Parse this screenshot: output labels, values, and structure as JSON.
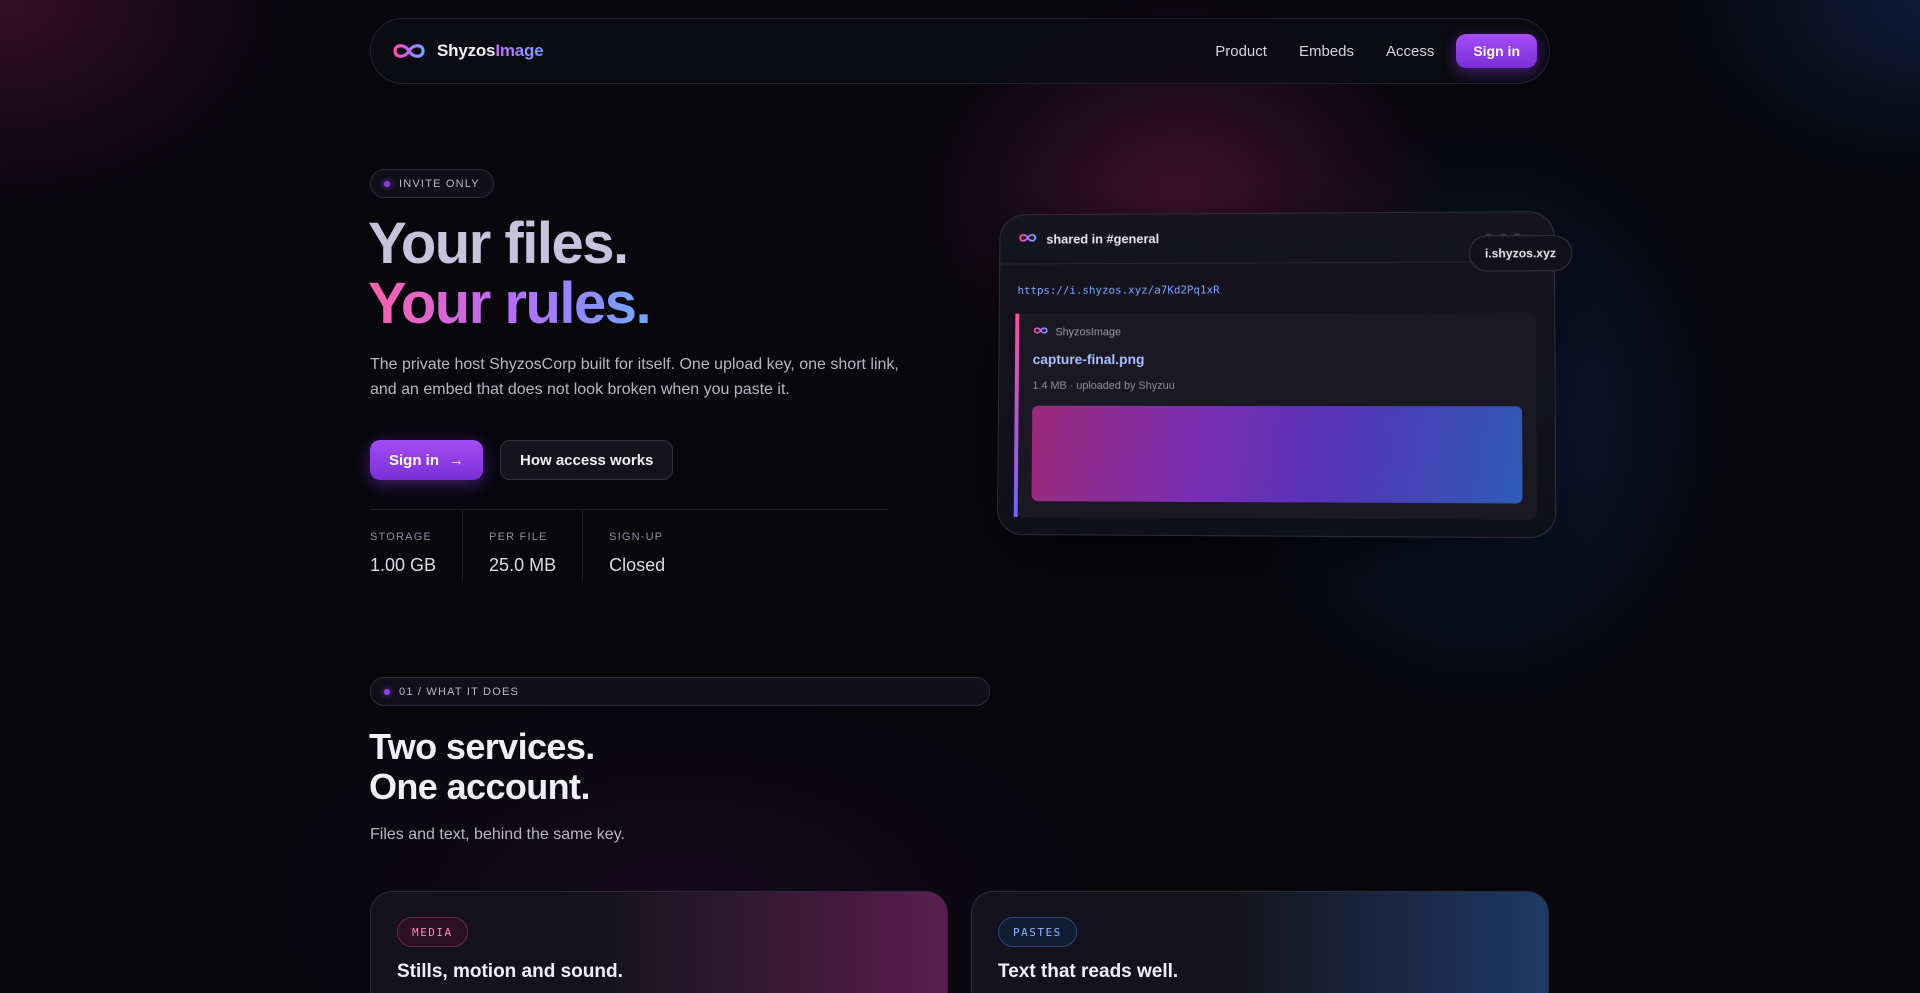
{
  "brand": {
    "name_part1": "Shyzos",
    "name_part2": "Image",
    "logo_icon": "infinity-icon"
  },
  "nav": {
    "links": [
      "Product",
      "Embeds",
      "Access"
    ],
    "signin_label": "Sign in"
  },
  "hero": {
    "badge": "INVITE ONLY",
    "title_line1": "Your files.",
    "title_line2": "Your rules.",
    "description": "The private host ShyzosCorp built for itself. One upload key, one short link, and an embed that does not look broken when you paste it.",
    "primary_cta": "Sign in",
    "primary_cta_arrow": "→",
    "secondary_cta": "How access works",
    "stats": [
      {
        "label": "STORAGE",
        "value": "1.00 GB"
      },
      {
        "label": "PER FILE",
        "value": "25.0 MB"
      },
      {
        "label": "SIGN-UP",
        "value": "Closed"
      }
    ]
  },
  "embed_preview": {
    "header_title": "shared in #general",
    "domain_tag": "i.shyzos.xyz",
    "url": "https://i.shyzos.xyz/a7Kd2Pq1xR",
    "card": {
      "provider": "ShyzosImage",
      "title": "capture-final.png",
      "meta": "1.4 MB · uploaded by Shyzuu"
    }
  },
  "section_services": {
    "badge": "01 / WHAT IT DOES",
    "title_line1": "Two services.",
    "title_line2": "One account.",
    "description": "Files and text, behind the same key.",
    "cards": [
      {
        "tag": "MEDIA",
        "heading": "Stills, motion and sound."
      },
      {
        "tag": "PASTES",
        "heading": "Text that reads well."
      }
    ]
  },
  "colors": {
    "accent_purple": "#8a3fe6",
    "gradient_pink": "#ff5fa8",
    "gradient_blue": "#6ea8ff",
    "background": "#07070c"
  }
}
